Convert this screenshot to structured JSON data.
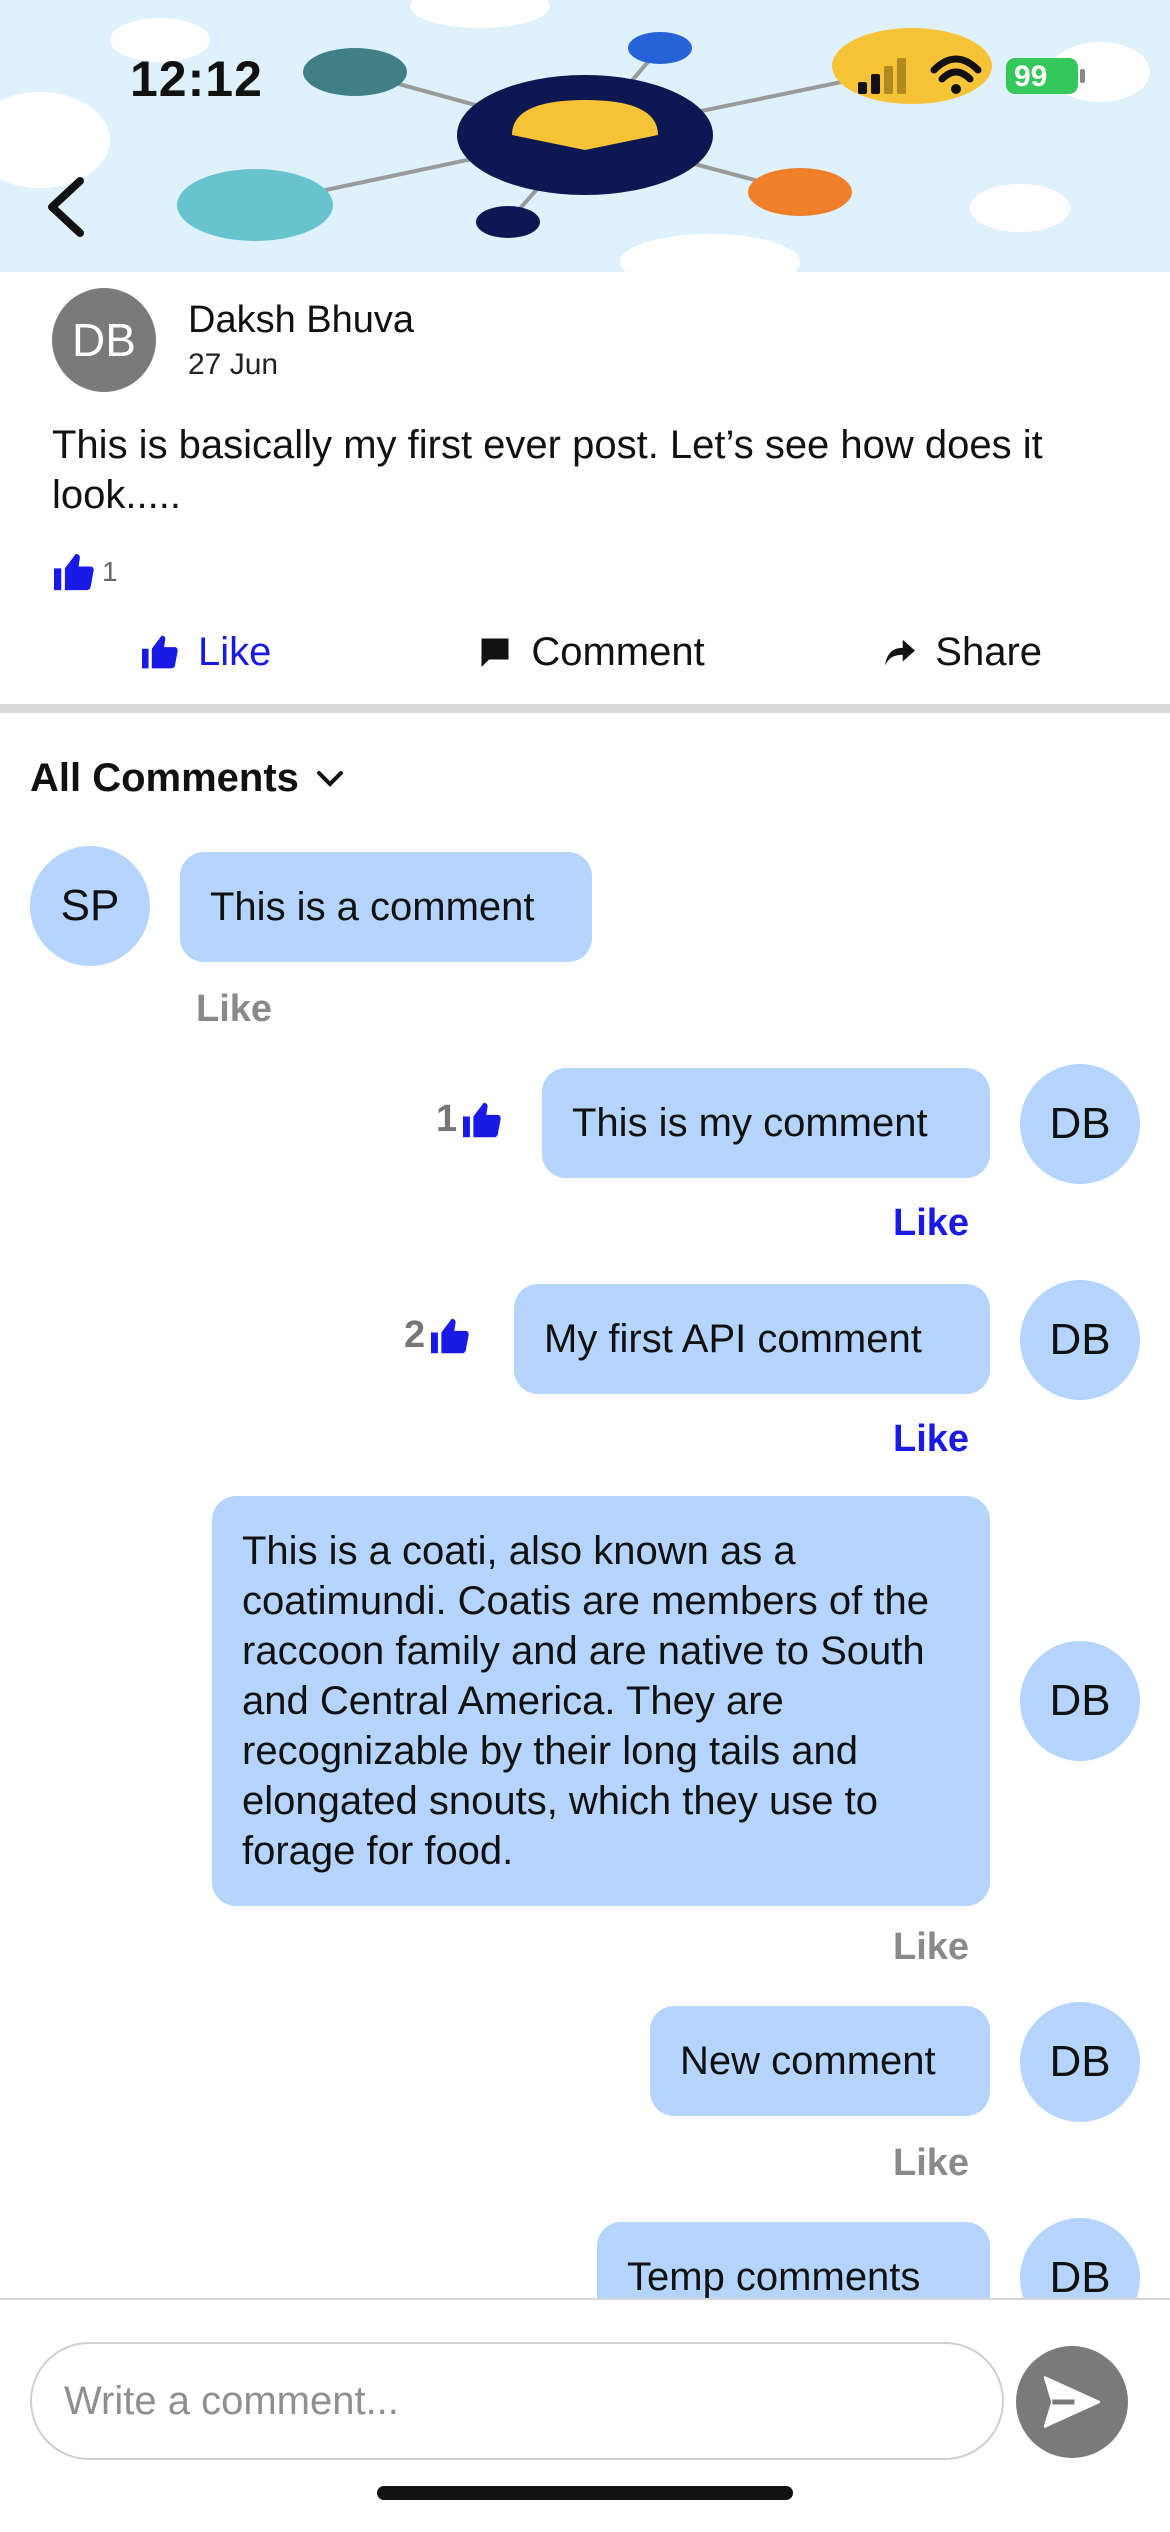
{
  "status_bar": {
    "time": "12:12",
    "battery": "99"
  },
  "colors": {
    "accent_blue": "#1a1ae6",
    "bubble": "#b5d4ff",
    "gray_avatar": "#7a7a7a"
  },
  "post": {
    "author_initials": "DB",
    "author_name": "Daksh Bhuva",
    "date": "27 Jun",
    "body": "This is basically my first ever post. Let’s see how does it look.....",
    "like_count": "1"
  },
  "actions": {
    "like": "Like",
    "comment": "Comment",
    "share": "Share"
  },
  "comments_heading": "All Comments",
  "comments": [
    {
      "initials": "SP",
      "text": "This is a comment",
      "like_label": "Like",
      "reactions": ""
    },
    {
      "initials": "DB",
      "text": "This is my comment",
      "like_label": "Like",
      "reactions": "1"
    },
    {
      "initials": "DB",
      "text": "My first API comment",
      "like_label": "Like",
      "reactions": "2"
    },
    {
      "initials": "DB",
      "text": "This is a coati, also known as a coatimundi. Coatis are members of the raccoon family and are native to South and Central America. They are recognizable by their long tails and elongated snouts, which they use to forage for food.",
      "like_label": "Like",
      "reactions": ""
    },
    {
      "initials": "DB",
      "text": "New comment",
      "like_label": "Like",
      "reactions": ""
    },
    {
      "initials": "DB",
      "text": "Temp comments",
      "like_label": "",
      "reactions": ""
    }
  ],
  "input": {
    "placeholder": "Write a comment..."
  },
  "icons": [
    "back-arrow-icon",
    "thumbs-up-icon",
    "comment-icon",
    "share-arrow-icon",
    "chevron-down-icon",
    "send-icon",
    "signal-icon",
    "wifi-icon",
    "battery-icon"
  ]
}
